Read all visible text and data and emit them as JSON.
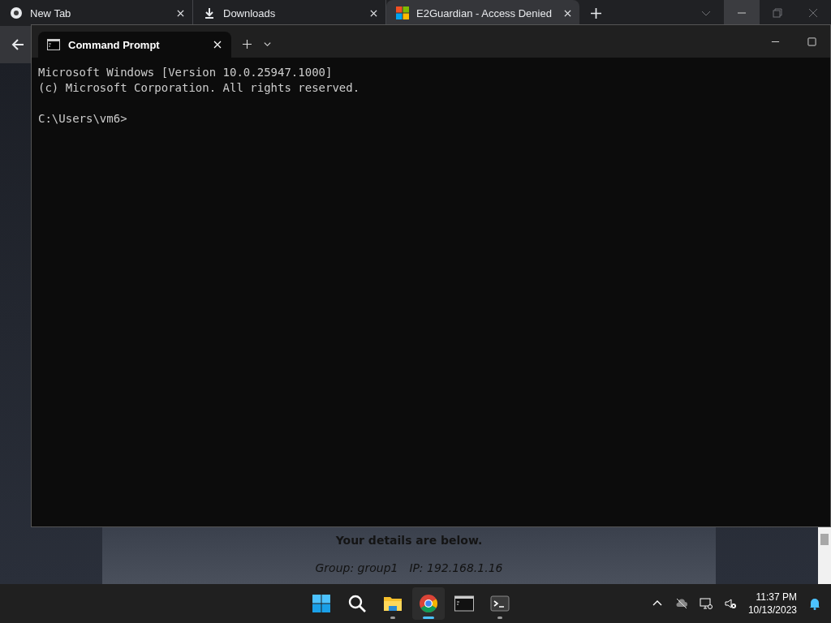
{
  "browser": {
    "tabs": [
      {
        "title": "New Tab",
        "kind": "chrome",
        "selected": false
      },
      {
        "title": "Downloads",
        "kind": "download",
        "selected": false
      },
      {
        "title": "E2Guardian - Access Denied",
        "kind": "windows",
        "selected": true
      }
    ],
    "page": {
      "heading": "Your details are below.",
      "group": "Group: group1",
      "ip": "IP: 192.168.1.16"
    }
  },
  "terminal": {
    "tab_title": "Command Prompt",
    "output": [
      "Microsoft Windows [Version 10.0.25947.1000]",
      "(c) Microsoft Corporation. All rights reserved."
    ],
    "prompt": "C:\\Users\\vm6>"
  },
  "taskbar": {
    "apps": [
      {
        "kind": "start",
        "running": false,
        "active": false
      },
      {
        "kind": "search",
        "running": false,
        "active": false
      },
      {
        "kind": "explorer",
        "running": true,
        "active": false
      },
      {
        "kind": "chrome",
        "running": true,
        "active": true
      },
      {
        "kind": "cmd",
        "running": false,
        "active": false
      },
      {
        "kind": "terminal",
        "running": true,
        "active": false
      }
    ],
    "time": "11:37 PM",
    "date": "10/13/2023"
  }
}
